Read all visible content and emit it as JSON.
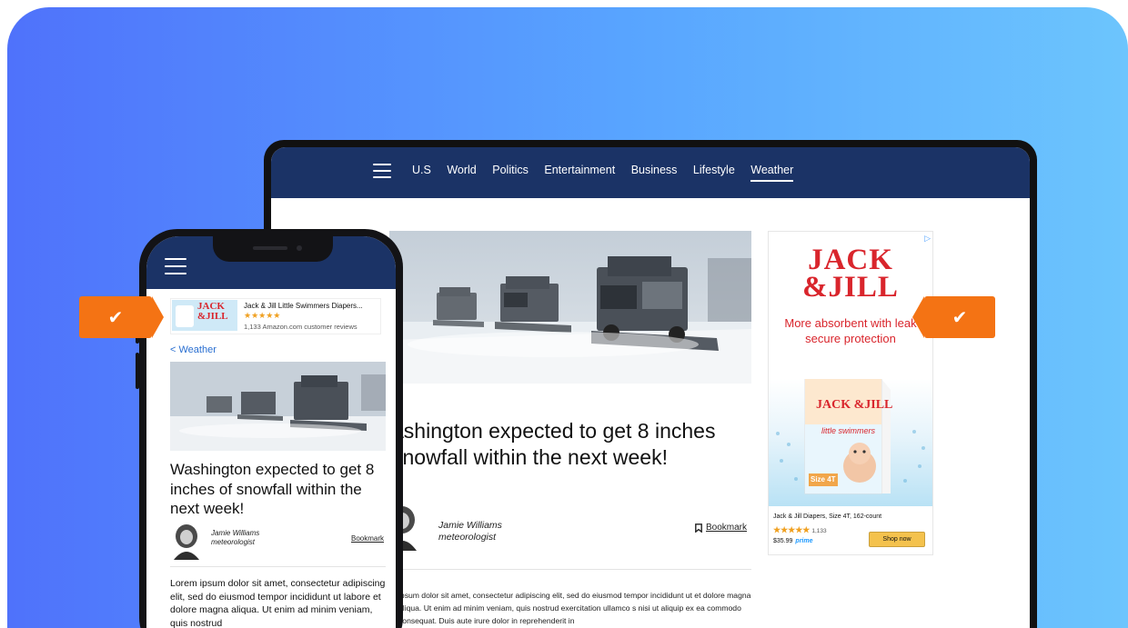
{
  "tablet": {
    "nav": {
      "items": [
        {
          "label": "U.S"
        },
        {
          "label": "World"
        },
        {
          "label": "Politics"
        },
        {
          "label": "Entertainment"
        },
        {
          "label": "Business"
        },
        {
          "label": "Lifestyle"
        },
        {
          "label": "Weather",
          "active": true
        }
      ]
    },
    "article": {
      "title": "ashington expected to get 8 inches snowfall within the next week!",
      "author_name": "Jamie Williams",
      "author_role": "meteorologist",
      "bookmark": "Bookmark",
      "body": "ipsum dolor sit amet, consectetur adipiscing elit, sed do eiusmod tempor incididunt ut et dolore magna aliqua. Ut enim ad minim veniam, quis nostrud exercitation ullamco s nisi ut aliquip ex ea commodo consequat. Duis aute irure dolor in reprehenderit in"
    },
    "ad": {
      "adchoice": "▷",
      "brand_line1": "JACK",
      "brand_line2": "&JILL",
      "tagline": "More absorbent with leak secure protection",
      "product_name": "Jack & Jill Diapers, Size 4T, 162-count",
      "stars": "★★★★★",
      "rating_count": "1,133",
      "price": "$35.99",
      "prime": "prime",
      "shop_label": "Shop now",
      "box_label": "Size 4T",
      "box_brand": "JACK &JILL",
      "box_sub": "little swimmers"
    }
  },
  "phone": {
    "ad": {
      "title": "Jack & Jill Little Swimmers Diapers...",
      "stars": "★★★★★",
      "reviews": "1,133 Amazon.com customer reviews",
      "logo": "JACK &JILL"
    },
    "back_label": "< Weather",
    "title": "Washington expected to get 8 inches of snowfall within the next week!",
    "author_name": "Jamie Williams",
    "author_role": "meteorologist",
    "bookmark": "Bookmark",
    "body": "Lorem ipsum dolor sit amet, consectetur adipiscing elit, sed do eiusmod tempor incididunt ut labore et dolore magna aliqua. Ut enim ad minim veniam, quis nostrud"
  },
  "badges": {
    "check": "✔"
  },
  "colors": {
    "nav": "#1b3366",
    "badge": "#f47314",
    "brand_red": "#d9252c",
    "bg_start": "#4f72fb",
    "bg_end": "#6cc5fd"
  }
}
